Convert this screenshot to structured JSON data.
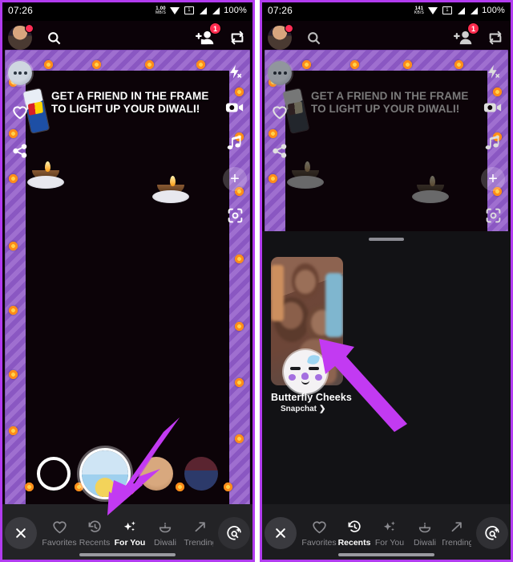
{
  "panels": [
    {
      "id": "left",
      "statusbar": {
        "time": "07:26",
        "net_rate": "1.00",
        "net_unit": "MB/S",
        "sim_label": "1",
        "battery": "100%",
        "icons": [
          "wifi-icon",
          "sim-card-icon",
          "signal-bar-icon",
          "signal-bar-icon"
        ]
      },
      "header": {
        "avatar": "profile-avatar",
        "avatar_badge": "",
        "search": "search-icon",
        "add_friend": "add-friend-icon",
        "add_friend_count": "1",
        "flip_camera": "flip-camera-icon"
      },
      "camera": {
        "banner_line1": "GET A FRIEND IN THE FRAME",
        "banner_line2": "TO LIGHT UP YOUR DIWALI!",
        "brand_object": "redbull-can",
        "rail_left": [
          "chat-dots-icon",
          "heart-icon",
          "share-icon"
        ],
        "rail_right": [
          "flash-off-icon",
          "video-camera-icon",
          "music-note-icon",
          "plus-icon",
          "scan-icon"
        ]
      },
      "controls": {
        "memories": "memories-icon",
        "shutter": "shutter-button",
        "lenses": [
          "lens-thumb-active",
          "lens-thumb-2",
          "lens-thumb-3"
        ]
      },
      "bottomnav": {
        "close": "close-icon",
        "explore": "explore-lens-icon",
        "tabs": [
          {
            "label": "Favorites",
            "icon": "heart-icon",
            "active": false
          },
          {
            "label": "Recents",
            "icon": "clock-history-icon",
            "active": false
          },
          {
            "label": "For You",
            "icon": "sparkles-icon",
            "active": true
          },
          {
            "label": "Diwali",
            "icon": "diya-lamp-icon",
            "active": false
          },
          {
            "label": "Trending",
            "icon": "trending-arrow-icon",
            "active": false
          }
        ]
      },
      "annotation": {
        "arrow": "arrow-pointing-down-left-to-recents"
      }
    },
    {
      "id": "right",
      "statusbar": {
        "time": "07:26",
        "net_rate": "141",
        "net_unit": "KB/S",
        "sim_label": "1",
        "battery": "100%",
        "icons": [
          "wifi-icon",
          "sim-card-icon",
          "signal-bar-icon",
          "signal-bar-icon"
        ]
      },
      "header": {
        "avatar": "profile-avatar",
        "avatar_badge": "",
        "search": "search-icon",
        "add_friend": "add-friend-icon",
        "add_friend_count": "1",
        "flip_camera": "flip-camera-icon"
      },
      "camera": {
        "banner_line1": "GET A FRIEND IN THE FRAME",
        "banner_line2": "TO LIGHT UP YOUR DIWALI!",
        "brand_object": "redbull-can",
        "rail_left": [
          "chat-dots-icon",
          "heart-icon",
          "share-icon"
        ],
        "rail_right": [
          "flash-off-icon",
          "video-camera-icon",
          "music-note-icon",
          "plus-icon",
          "scan-icon"
        ]
      },
      "sheet": {
        "handle": "drag-handle",
        "lens": {
          "title": "Butterfly Cheeks",
          "creator": "Snapchat",
          "creator_chevron": "❯",
          "icon": "butterfly-cheeks-lens-icon",
          "preview": "lens-preview-photo"
        }
      },
      "bottomnav": {
        "close": "close-icon",
        "explore": "explore-lens-icon",
        "tabs": [
          {
            "label": "Favorites",
            "icon": "heart-icon",
            "active": false
          },
          {
            "label": "Recents",
            "icon": "clock-history-icon",
            "active": true
          },
          {
            "label": "For You",
            "icon": "sparkles-icon",
            "active": false
          },
          {
            "label": "Diwali",
            "icon": "diya-lamp-icon",
            "active": false
          },
          {
            "label": "Trending",
            "icon": "trending-arrow-icon",
            "active": false
          }
        ]
      },
      "annotation": {
        "arrow": "arrow-pointing-up-left-to-lens-card"
      }
    }
  ],
  "colors": {
    "accent_arrow": "#c23af2",
    "frame_purple": "#9f6fd0",
    "flower_orange": "#ff8c1a",
    "badge_red": "#ff2b4e",
    "sheet_bg": "#121215",
    "nav_bg": "#1c1c1f"
  }
}
